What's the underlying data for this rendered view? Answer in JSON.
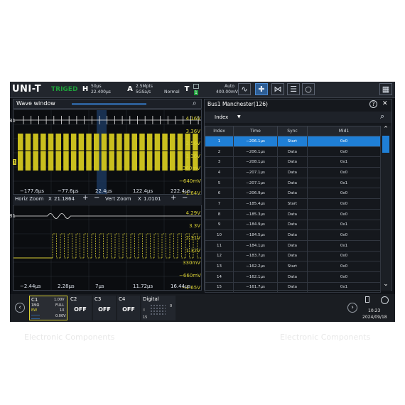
{
  "watermark": {
    "text_left": "Electronic Components",
    "text_right": "Electronic Components"
  },
  "topbar": {
    "logo": "UNI-T",
    "trigger_state": "TRIGED",
    "h_key": "H",
    "h_timebase": "50μs",
    "h_position": "22.400μs",
    "a_key": "A",
    "a_depth": "2.5Mpts",
    "a_rate": "5GSa/s",
    "a_mode": "Normal",
    "t_key": "T",
    "t_source": "1",
    "t_mode": "Auto",
    "t_level": "400.00mV"
  },
  "wave_window": {
    "title": "Wave window",
    "y_labels": [
      "4.16V",
      "3.36V",
      "2.56V",
      "1.36V",
      "360mV",
      "−640mV",
      "−1.64V"
    ],
    "x_labels": [
      "−177.6μs",
      "−77.6μs",
      "22.4μs",
      "122.4μs",
      "222.4μs"
    ],
    "ch_marker": "1",
    "bus_marker": "B1"
  },
  "zoom": {
    "horiz_label": "Horiz Zoom",
    "horiz_value": "21.1864",
    "vert_label": "Vert Zoom",
    "vert_value": "1.0101",
    "plus": "+",
    "minus": "−",
    "x_sep": "X"
  },
  "zoom_window": {
    "y_labels": [
      "4.29V",
      "3.3V",
      "2.31V",
      "1.32V",
      "330mV",
      "−660mV",
      "−1.65V"
    ],
    "x_labels": [
      "−2.44μs",
      "2.28μs",
      "7μs",
      "11.72μs",
      "16.44μs"
    ],
    "bus_marker": "B1"
  },
  "decode": {
    "title": "Bus1 Manchester(126)",
    "help": "?",
    "close": "✕",
    "filter_label": "Index",
    "columns": [
      "Index",
      "Time",
      "Sync",
      "Mid1"
    ],
    "rows": [
      [
        "1",
        "−206.1μs",
        "Start",
        "0x0"
      ],
      [
        "2",
        "−206.1μs",
        "Data",
        "0x0"
      ],
      [
        "3",
        "−208.1μs",
        "Data",
        "0x1"
      ],
      [
        "4",
        "−207.1μs",
        "Data",
        "0x0"
      ],
      [
        "5",
        "−207.1μs",
        "Data",
        "0x1"
      ],
      [
        "6",
        "−206.9μs",
        "Data",
        "0x0"
      ],
      [
        "7",
        "−185.4μs",
        "Start",
        "0x0"
      ],
      [
        "8",
        "−185.3μs",
        "Data",
        "0x0"
      ],
      [
        "9",
        "−184.9μs",
        "Data",
        "0x1"
      ],
      [
        "10",
        "−184.5μs",
        "Data",
        "0x0"
      ],
      [
        "11",
        "−184.1μs",
        "Data",
        "0x1"
      ],
      [
        "12",
        "−183.7μs",
        "Data",
        "0x0"
      ],
      [
        "13",
        "−162.2μs",
        "Start",
        "0x0"
      ],
      [
        "14",
        "−162.1μs",
        "Data",
        "0x0"
      ],
      [
        "15",
        "−161.7μs",
        "Data",
        "0x1"
      ]
    ],
    "selected_row": 0
  },
  "channels": {
    "c1": {
      "name": "C1",
      "scale": "1.00V",
      "imp": "1MΩ",
      "bw": "FULL",
      "probe": "1X",
      "bw_lim": "BW",
      "offset": "0.00V"
    },
    "c2": {
      "name": "C2",
      "state": "OFF"
    },
    "c3": {
      "name": "C3",
      "state": "OFF"
    },
    "c4": {
      "name": "C4",
      "state": "OFF"
    },
    "digital": {
      "name": "Digital",
      "low": "0",
      "high": "15",
      "mid": "8"
    }
  },
  "status": {
    "time": "10:23",
    "date": "2024/09/18"
  },
  "colors": {
    "ch1": "#d9d033",
    "accent": "#1f7fd6",
    "trig": "#1e9e3a"
  }
}
